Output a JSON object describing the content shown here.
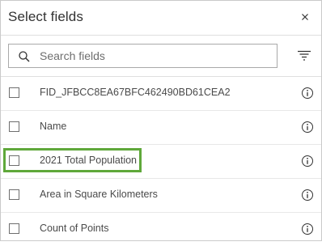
{
  "header": {
    "title": "Select fields"
  },
  "search": {
    "placeholder": "Search fields",
    "value": ""
  },
  "fields": [
    {
      "label": "FID_JFBCC8EA67BFC462490BD61CEA2",
      "checked": false
    },
    {
      "label": "Name",
      "checked": false
    },
    {
      "label": "2021 Total Population",
      "checked": false,
      "highlighted": true
    },
    {
      "label": "Area in Square Kilometers",
      "checked": false
    },
    {
      "label": "Count of Points",
      "checked": false
    }
  ],
  "colors": {
    "highlight": "#5fa83a",
    "text": "#323232",
    "border": "#cacaca"
  },
  "icons": {
    "close": "close-icon",
    "search": "search-icon",
    "sort": "sort-icon",
    "info": "info-icon"
  }
}
